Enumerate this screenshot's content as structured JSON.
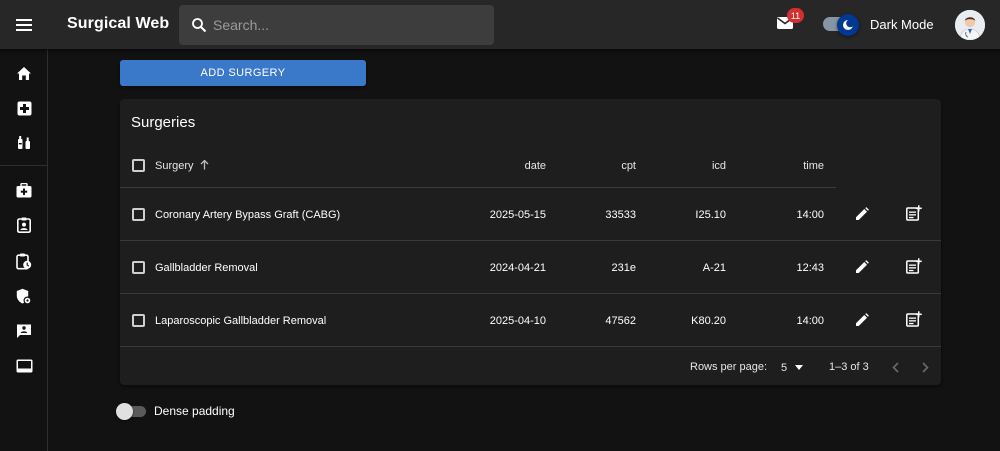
{
  "app": {
    "title": "Surgical Web"
  },
  "search": {
    "placeholder": "Search..."
  },
  "header": {
    "mail_badge": "11",
    "dark_mode_label": "Dark Mode",
    "dark_mode_on": true
  },
  "sidebar": {
    "items": [
      {
        "name": "home-icon"
      },
      {
        "name": "medical-plus-icon"
      },
      {
        "name": "vaccine-icon"
      },
      {
        "name": "medical-bag-icon"
      },
      {
        "name": "badge-icon"
      },
      {
        "name": "clipboard-clock-icon"
      },
      {
        "name": "shield-gear-icon"
      },
      {
        "name": "chat-person-icon"
      },
      {
        "name": "monitor-icon"
      }
    ]
  },
  "actions": {
    "add_surgery_label": "ADD SURGERY"
  },
  "table": {
    "title": "Surgeries",
    "columns": [
      "Surgery",
      "date",
      "cpt",
      "icd",
      "time"
    ],
    "sort_column": "Surgery",
    "rows": [
      {
        "surgery": "Coronary Artery Bypass Graft (CABG)",
        "date": "2025-05-15",
        "cpt": "33533",
        "icd": "I25.10",
        "time": "14:00"
      },
      {
        "surgery": "Gallbladder Removal",
        "date": "2024-04-21",
        "cpt": "231e",
        "icd": "A-21",
        "time": "12:43"
      },
      {
        "surgery": "Laparoscopic Gallbladder Removal",
        "date": "2025-04-10",
        "cpt": "47562",
        "icd": "K80.20",
        "time": "14:00"
      }
    ],
    "pagination": {
      "rows_per_page_label": "Rows per page:",
      "rows_per_page": "5",
      "range": "1–3 of 3"
    }
  },
  "dense_padding": {
    "label": "Dense padding",
    "on": false
  },
  "colors": {
    "accent": "#3a78c9",
    "badge": "#d32f2f",
    "toggle_thumb": "#003892",
    "appbar": "#272727",
    "background": "#121212",
    "card": "#1e1e1e"
  }
}
